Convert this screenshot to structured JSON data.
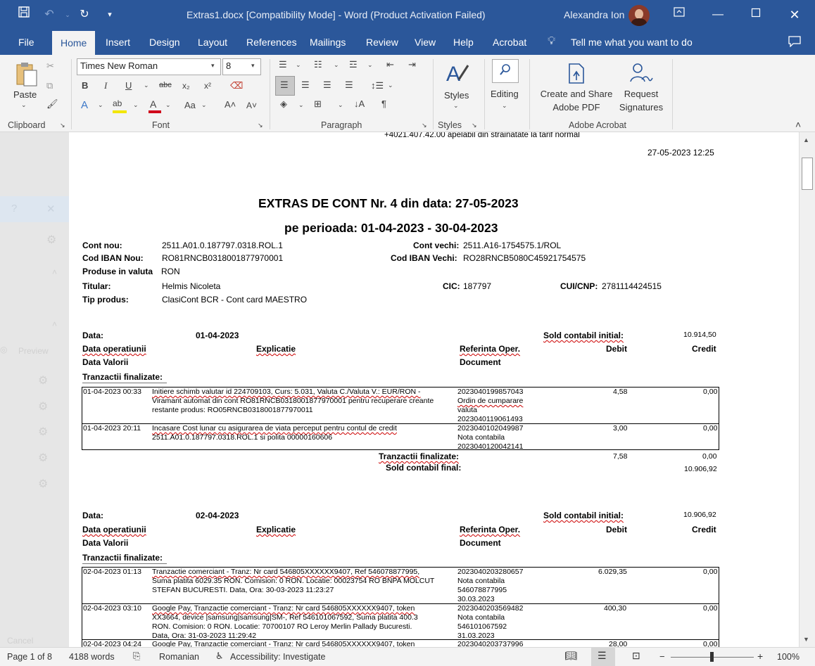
{
  "window": {
    "title": "Extras1.docx [Compatibility Mode]  -  Word (Product Activation Failed)",
    "user": "Alexandra Ion"
  },
  "menu": {
    "tabs": [
      "File",
      "Home",
      "Insert",
      "Design",
      "Layout",
      "References",
      "Mailings",
      "Review",
      "View",
      "Help",
      "Acrobat"
    ],
    "tell_me": "Tell me what you want to do"
  },
  "ribbon": {
    "paste": "Paste",
    "font_name": "Times New Roman",
    "font_size": "8",
    "styles": "Styles",
    "editing": "Editing",
    "create_share_1": "Create and Share",
    "create_share_2": "Adobe PDF",
    "request_1": "Request",
    "request_2": "Signatures",
    "groups": {
      "clipboard": "Clipboard",
      "font": "Font",
      "paragraph": "Paragraph",
      "styles": "Styles",
      "adobe": "Adobe Acrobat"
    }
  },
  "leftpane": {
    "preview": "Preview",
    "cancel": "Cancel"
  },
  "doc": {
    "top_cut": "+4021.407.42.00 apelabil din strainatate la tarif normal",
    "datetime": "27-05-2023 12:25",
    "title1": "EXTRAS DE CONT Nr. 4 din data: 27-05-2023",
    "title2": "pe perioada: 01-04-2023 - 30-04-2023",
    "cont_nou_label": "Cont nou:",
    "cont_nou": "2511.A01.0.187797.0318.ROL.1",
    "cont_vechi_label": "Cont vechi:",
    "cont_vechi": "2511.A16-1754575.1/ROL",
    "iban_nou_label": "Cod IBAN Nou:",
    "iban_nou": "RO81RNCB0318001877970001",
    "iban_vechi_label": "Cod IBAN Vechi:",
    "iban_vechi": "RO28RNCB5080C45921754575",
    "produse_label": "Produse in valuta",
    "produse": "RON",
    "titular_label": "Titular:",
    "titular": "Helmis Nicoleta",
    "cic_label": "CIC:",
    "cic": "187797",
    "cui_label": "CUI/CNP:",
    "cui": "2781114424515",
    "tip_label": "Tip produs:",
    "tip": "ClasiCont BCR - Cont card MAESTRO",
    "h_data": "Data:",
    "h_sold_init": "Sold contabil initial:",
    "h_data_op": "Data operatiunii",
    "h_explicatie": "Explicatie",
    "h_referinta": "Referinta Oper.",
    "h_debit": "Debit",
    "h_credit": "Credit",
    "h_data_val": "Data Valorii",
    "h_document": "Document",
    "h_tranz": "Tranzactii finalizate:",
    "h_sold_final": "Sold contabil final:",
    "day1": {
      "date": "01-04-2023",
      "sold_init": "10.914,50",
      "rows": [
        {
          "dt": "01-04-2023 00:33",
          "l1": " Initiere schimb valutar id 224709103, Curs: 5.031, Valuta C./Valuta V.: EUR/RON -",
          "l2": "Viramant automat din cont RO81RNCB0318001877970001 pentru recuperare creante",
          "l3": "restante produs: RO05RNCB0318001877970011",
          "r1": "2023040199857043",
          "r2": "Ordin de cumparare",
          "r3": "valuta",
          "r4": "2023040119061493",
          "debit": "4,58",
          "credit": "0,00"
        },
        {
          "dt": "01-04-2023 20:11",
          "l1": "Incasare Cost lunar cu asigurarea de viata perceput pentru contul de credit",
          "l2": "2511.A01.0.187797.0318.ROL.1 si polita 00000160606",
          "l3": "",
          "r1": "2023040102049987",
          "r2": "Nota contabila",
          "r3": "2023040120042141",
          "r4": "",
          "debit": "3,00",
          "credit": "0,00"
        }
      ],
      "tot_debit": "7,58",
      "tot_credit": "0,00",
      "sold_final": "10.906,92"
    },
    "day2": {
      "date": "02-04-2023",
      "sold_init": "10.906,92",
      "rows": [
        {
          "dt": "02-04-2023 01:13",
          "l1": "Tranzactie comerciant - Tranz: Nr card 546805XXXXXX9407, Ref 546078877995,",
          "l2": "Suma platita 6029.35 RON. Comision: 0 RON. Locatie: 00023754 RO BNPA MOLCUT",
          "l3": "STEFAN BUCURESTI. Data, Ora: 30-03-2023 11:23:27",
          "r1": "2023040203280657",
          "r2": "Nota contabila",
          "r3": "546078877995",
          "r4": "30.03.2023",
          "debit": "6.029,35",
          "credit": "0,00"
        },
        {
          "dt": "02-04-2023 03:10",
          "l1": "Google Pay, Tranzactie comerciant - Tranz: Nr card 546805XXXXXX9407, token",
          "l2": "XX3664, device |samsung|samsung|SM-, Ref 546101067592, Suma platita 400.3",
          "l3": "RON. Comision: 0 RON. Locatie: 70700107 RO Leroy Merlin Pallady Bucuresti.",
          "l4": "Data, Ora: 31-03-2023 11:29:42",
          "r1": "2023040203569482",
          "r2": "Nota contabila",
          "r3": "546101067592",
          "r4": "31.03.2023",
          "debit": "400,30",
          "credit": "0,00"
        },
        {
          "dt": "02-04-2023 04:24",
          "l1": "Google Pay, Tranzactie comerciant - Tranz: Nr card 546805XXXXXX9407, token",
          "r1": "2023040203737996",
          "debit": "28,00",
          "credit": "0,00"
        }
      ]
    }
  },
  "status": {
    "page": "Page 1 of 8",
    "words": "4188 words",
    "lang": "Romanian",
    "access": "Accessibility: Investigate",
    "zoom": "100%"
  }
}
